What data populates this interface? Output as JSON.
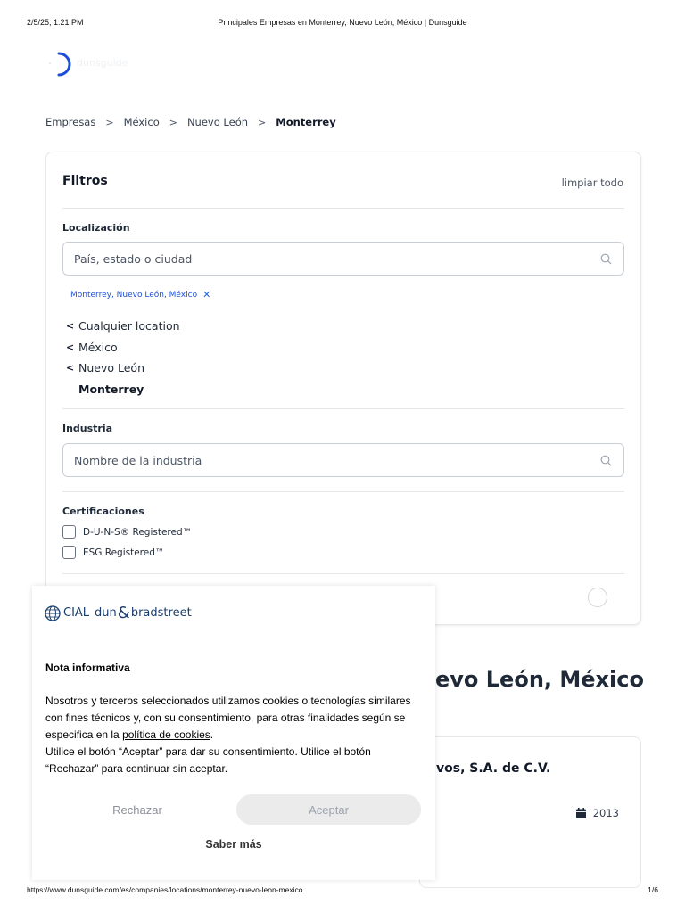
{
  "print": {
    "date": "2/5/25, 1:21 PM",
    "title": "Principales Empresas en Monterrey, Nuevo León, México | Dunsguide",
    "url": "https://www.dunsguide.com/es/companies/locations/monterrey-nuevo-leon-mexico",
    "page": "1/6"
  },
  "logo": {
    "text": "dunsguide",
    "icon": "logo-ring-icon",
    "accent": "#1d4ed8"
  },
  "breadcrumb": {
    "items": [
      "Empresas",
      "México",
      "Nuevo León",
      "Monterrey"
    ],
    "separator": ">"
  },
  "filters": {
    "title": "Filtros",
    "clear_all": "limpiar todo",
    "location": {
      "label": "Localización",
      "placeholder": "País, estado o ciudad",
      "chip": "Monterrey, Nuevo León, México",
      "hierarchy": [
        "Cualquier location",
        "México",
        "Nuevo León"
      ],
      "current": "Monterrey"
    },
    "industry": {
      "label": "Industria",
      "placeholder": "Nombre de la industria"
    },
    "certifications": {
      "label": "Certificaciones",
      "options": [
        "D-U-N-S® Registered™",
        "ESG Registered™"
      ]
    }
  },
  "results": {
    "heading_partial": "evo León, México",
    "company_name_partial": "vos, S.A. de C.V.",
    "company_year": "2013"
  },
  "cookie": {
    "brand": {
      "cial": "CIAL",
      "dun": "dun",
      "amp": "&",
      "bradstreet": "bradstreet"
    },
    "heading": "Nota informativa",
    "body_1": "Nosotros y terceros seleccionados utilizamos cookies o tecnologías similares con fines técnicos y, con su consentimiento, para otras finalidades según se especifica en la ",
    "body_link": "política de cookies",
    "body_2": ".",
    "body_3": "Utilice el botón “Aceptar” para dar su consentimiento. Utilice el botón “Rechazar” para continuar sin aceptar.",
    "reject": "Rechazar",
    "accept": "Aceptar",
    "more": "Saber más"
  }
}
